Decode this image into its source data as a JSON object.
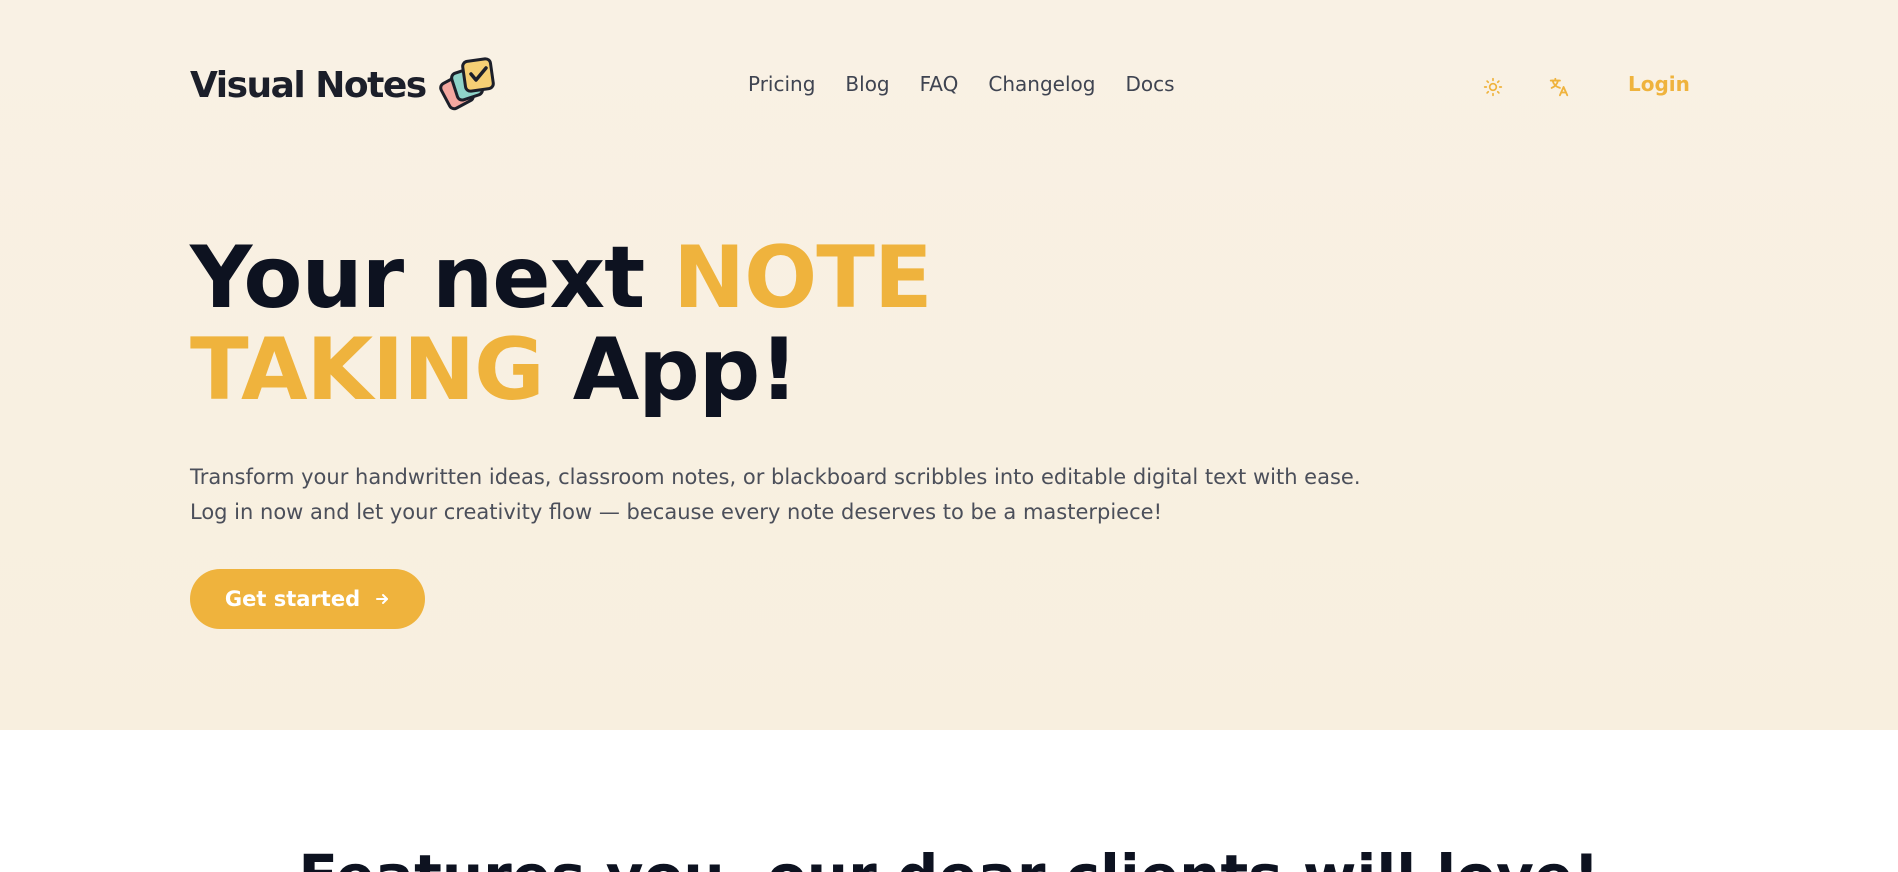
{
  "brand": {
    "name": "Visual Notes",
    "logo_icon": "stacked-notes-checkmark-icon"
  },
  "nav": {
    "items": [
      {
        "label": "Pricing"
      },
      {
        "label": "Blog"
      },
      {
        "label": "FAQ"
      },
      {
        "label": "Changelog"
      },
      {
        "label": "Docs"
      }
    ]
  },
  "header_actions": {
    "theme_icon": "sun-icon",
    "language_icon": "translate-icon",
    "login_label": "Login"
  },
  "hero": {
    "headline_part1": "Your next ",
    "headline_accent1": "NOTE",
    "headline_accent2": "TAKING",
    "headline_part2": " App!",
    "subtitle_line1": "Transform your handwritten ideas, classroom notes, or blackboard scribbles into editable digital text with ease.",
    "subtitle_line2": "Log in now and let your creativity flow — because every note deserves to be a masterpiece!",
    "cta_label": "Get started",
    "cta_icon": "arrow-right-icon"
  },
  "features": {
    "title": "Features you, our dear clients will love!"
  },
  "colors": {
    "accent": "#efb33d",
    "hero_background": "#f9f1e4",
    "heading": "#0d1220",
    "body_text": "#4b4f5a"
  }
}
